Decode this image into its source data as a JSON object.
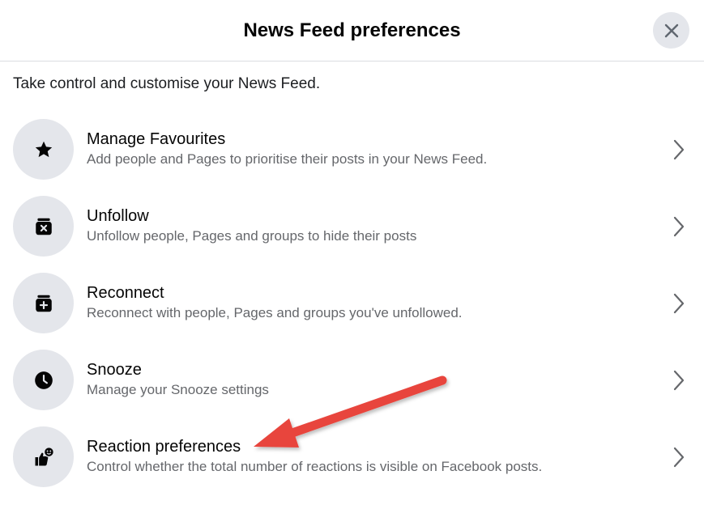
{
  "dialog": {
    "title": "News Feed preferences",
    "subtitle": "Take control and customise your News Feed.",
    "close_icon": "close-icon"
  },
  "items": [
    {
      "title": "Manage Favourites",
      "description": "Add people and Pages to prioritise their posts in your News Feed.",
      "icon": "star-icon"
    },
    {
      "title": "Unfollow",
      "description": "Unfollow people, Pages and groups to hide their posts",
      "icon": "unfollow-box-icon"
    },
    {
      "title": "Reconnect",
      "description": "Reconnect with people, Pages and groups you've unfollowed.",
      "icon": "reconnect-box-icon"
    },
    {
      "title": "Snooze",
      "description": "Manage your Snooze settings",
      "icon": "clock-icon"
    },
    {
      "title": "Reaction preferences",
      "description": "Control whether the total number of reactions is visible on Facebook posts.",
      "icon": "reaction-icon"
    }
  ],
  "annotation": {
    "arrow_color": "#e8453c",
    "arrow_target": "Reaction preferences"
  }
}
